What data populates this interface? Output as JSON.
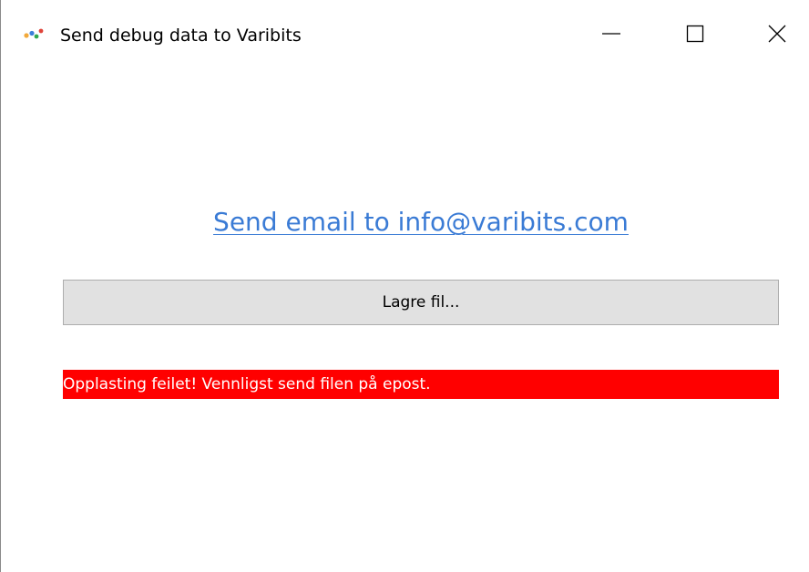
{
  "window": {
    "title": "Send debug data to Varibits",
    "controls": {
      "minimize": "minimize",
      "maximize": "maximize",
      "close": "close"
    }
  },
  "main": {
    "email_link_text": "Send email to info@varibits.com",
    "save_button_label": "Lagre fil...",
    "error_message": "Opplasting feilet! Vennligst send filen på epost."
  },
  "colors": {
    "link": "#3a7bd5",
    "button_background": "#e1e1e1",
    "error_background": "#ff0000",
    "error_text": "#ffffff"
  },
  "icons": {
    "app": "varibits-app-icon",
    "minimize": "minimize-icon",
    "maximize": "maximize-icon",
    "close": "close-icon"
  }
}
